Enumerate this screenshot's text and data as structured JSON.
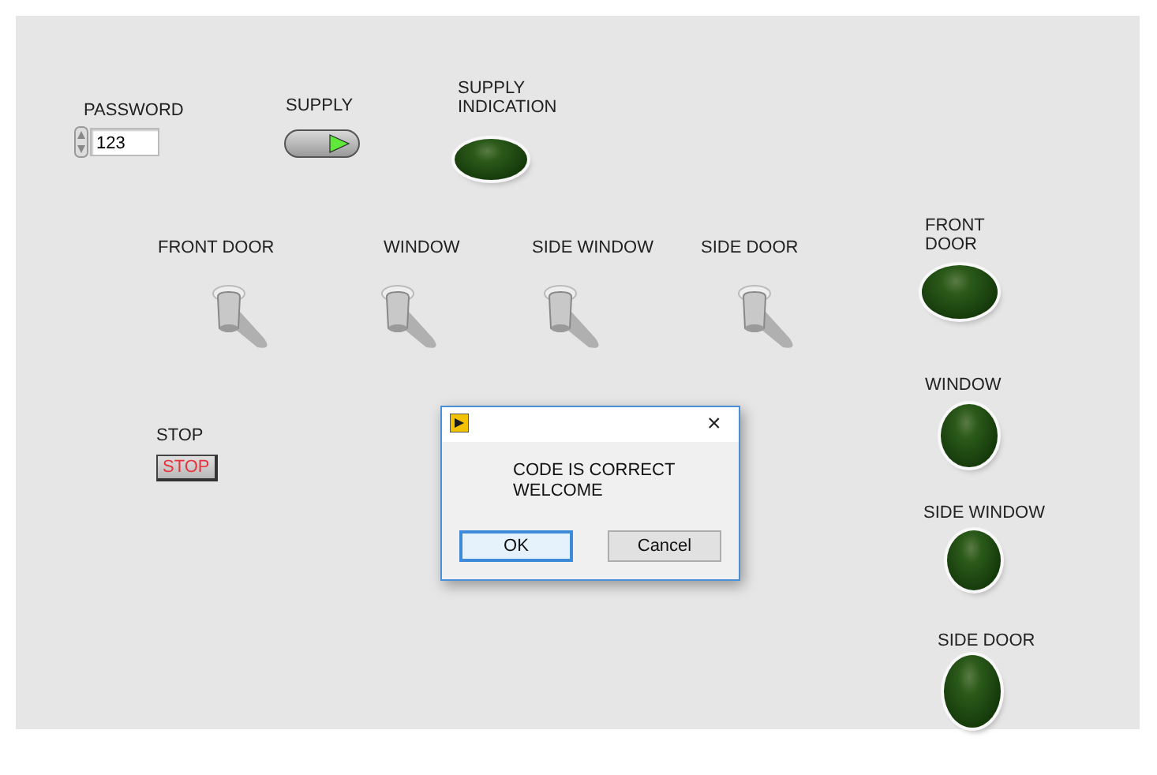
{
  "password": {
    "label": "PASSWORD",
    "value": "123"
  },
  "supply": {
    "label": "SUPPLY",
    "on": true
  },
  "supply_indication": {
    "label": "SUPPLY INDICATION",
    "on": false
  },
  "switches": [
    {
      "label": "FRONT DOOR",
      "on": false
    },
    {
      "label": "WINDOW",
      "on": false
    },
    {
      "label": "SIDE WINDOW",
      "on": false
    },
    {
      "label": "SIDE DOOR",
      "on": false
    }
  ],
  "stop": {
    "label": "STOP",
    "button": "STOP"
  },
  "indicators": [
    {
      "label": "FRONT DOOR",
      "on": false
    },
    {
      "label": "WINDOW",
      "on": false
    },
    {
      "label": "SIDE WINDOW",
      "on": false
    },
    {
      "label": "SIDE DOOR",
      "on": false
    }
  ],
  "dialog": {
    "close": "×",
    "message_lines": [
      "CODE IS CORRECT",
      "WELCOME"
    ],
    "buttons": [
      {
        "label": "OK",
        "selected": true
      },
      {
        "label": "Cancel",
        "selected": false
      }
    ]
  }
}
